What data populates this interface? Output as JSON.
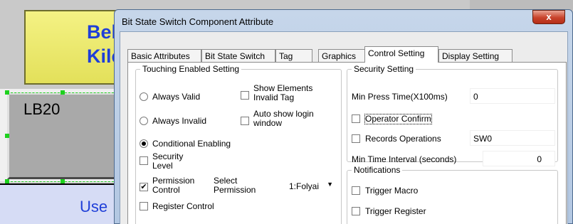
{
  "background": {
    "yellow_button": {
      "line1": "Bel",
      "line2": "Kile"
    },
    "lb_button": {
      "label": "LB20"
    },
    "bottom_label": "Use"
  },
  "dialog": {
    "title": "Bit State Switch Component Attribute",
    "close_glyph": "x",
    "tabs": [
      {
        "label": "Basic Attributes"
      },
      {
        "label": "Bit State Switch"
      },
      {
        "label": "Tag"
      },
      {
        "label": "Graphics"
      },
      {
        "label": "Control Setting",
        "active": true
      },
      {
        "label": "Display Setting"
      }
    ],
    "touching": {
      "legend": "Touching Enabled Setting",
      "always_valid": "Always Valid",
      "always_invalid": "Always Invalid",
      "conditional": "Conditional Enabling",
      "show_elements": "Show Elements\nInvalid Tag",
      "auto_show_login": "Auto show login\nwindow",
      "security_level": "Security\nLevel",
      "permission_control": "Permission\nControl",
      "permission_control_checked": true,
      "select_permission": "Select\nPermission",
      "permission_value": "1:Folyai",
      "register_control": "Register Control"
    },
    "security": {
      "legend": "Security Setting",
      "min_press_label": "Min Press Time(X100ms)",
      "min_press_value": "0",
      "operator_confirm": "Operator Confirm",
      "records_operations": "Records Operations",
      "records_value": "SW0",
      "min_interval_label": "Min Time Interval (seconds)",
      "min_interval_value": "0"
    },
    "notifications": {
      "legend": "Notifications",
      "trigger_macro": "Trigger Macro",
      "trigger_register": "Trigger Register"
    }
  }
}
